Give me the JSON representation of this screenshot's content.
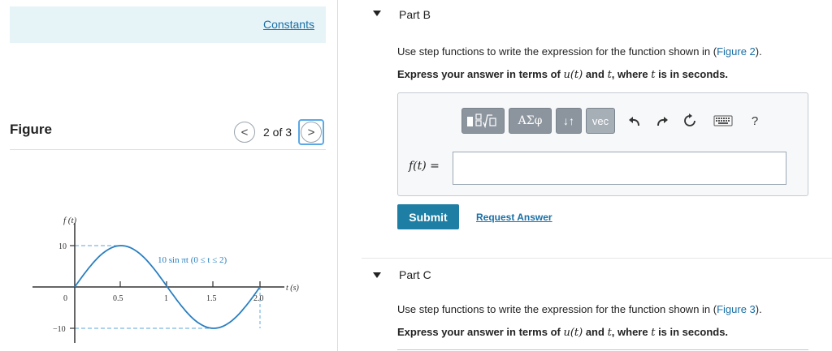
{
  "left": {
    "constants_link": "Constants",
    "figure_label": "Figure",
    "figure_counter": "2 of 3",
    "nav_prev_glyph": "<",
    "nav_next_glyph": ">"
  },
  "figure": {
    "y_axis_label": "f (t)",
    "x_axis_label": "t (s)",
    "curve_label": "10 sin πt  (0 ≤ t ≤ 2)",
    "y_ticks": [
      "10",
      "0",
      "−10"
    ],
    "x_ticks": [
      "0.5",
      "1",
      "1.5",
      "2.0"
    ],
    "amplitude": 10,
    "t_range": [
      0,
      2
    ],
    "curve_color": "#2a7fc0",
    "dashed_color": "#7ab8e0"
  },
  "partB": {
    "title": "Part B",
    "question_pre": "Use step functions to write the expression for the function shown in (",
    "question_link": "Figure 2",
    "question_post": ").",
    "instruction_a": "Express your answer in terms of ",
    "instruction_u": "u(t)",
    "instruction_b": " and ",
    "instruction_t": "t",
    "instruction_c": ", where ",
    "instruction_t2": "t",
    "instruction_d": " is in seconds.",
    "toolbar": {
      "templates_icon": "templates-icon",
      "greek_label": "ΑΣφ",
      "arrows_label": "↓↑",
      "vec_label": "vec",
      "undo_icon": "undo-icon",
      "redo_icon": "redo-icon",
      "reset_icon": "reset-icon",
      "keyboard_icon": "keyboard-icon",
      "help_label": "?"
    },
    "answer_label": "f(t) =",
    "answer_value": "",
    "submit_label": "Submit",
    "request_answer_label": "Request Answer"
  },
  "partC": {
    "title": "Part C",
    "question_pre": "Use step functions to write the expression for the function shown in (",
    "question_link": "Figure 3",
    "question_post": ").",
    "instruction_a": "Express your answer in terms of ",
    "instruction_u": "u(t)",
    "instruction_b": " and ",
    "instruction_t": "t",
    "instruction_c": ", where ",
    "instruction_t2": "t",
    "instruction_d": " is in seconds."
  },
  "colors": {
    "accent": "#1f7ea3",
    "link": "#1b6fa6",
    "constants_bg": "#e6f4f8",
    "toolbar_btn": "#8c959e"
  }
}
